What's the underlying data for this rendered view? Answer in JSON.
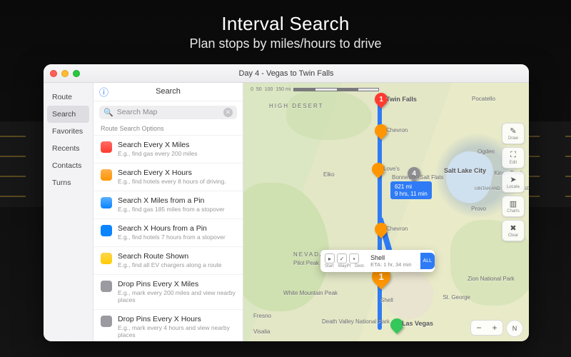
{
  "hero": {
    "title": "Interval Search",
    "subtitle": "Plan stops by miles/hours to drive"
  },
  "window": {
    "title": "Day 4 - Vegas to Twin Falls"
  },
  "leftnav": {
    "items": [
      "Route",
      "Search",
      "Favorites",
      "Recents",
      "Contacts",
      "Turns"
    ],
    "selectedIndex": 1
  },
  "midpane": {
    "header": "Search",
    "search_placeholder": "Search Map",
    "section": "Route Search Options",
    "options": [
      {
        "icon": "red",
        "title": "Search Every X Miles",
        "sub": "E.g., find gas every 200 miles"
      },
      {
        "icon": "teal",
        "title": "Search Every X Hours",
        "sub": "E.g., find hotels every 8 hours of driving."
      },
      {
        "icon": "blue",
        "title": "Search X Miles from a Pin",
        "sub": "E.g., find gas 185 miles from a stopover"
      },
      {
        "icon": "blue2",
        "title": "Search X Hours from a Pin",
        "sub": "E.g., find hotels 7 hours from a stopover"
      },
      {
        "icon": "yellow",
        "title": "Search Route Shown",
        "sub": "E.g., find all EV chargers along a route"
      },
      {
        "icon": "gray",
        "title": "Drop Pins Every X Miles",
        "sub": "E.g., mark every 200 miles and view nearby places"
      },
      {
        "icon": "gray",
        "title": "Drop Pins Every X Hours",
        "sub": "E.g., mark every 4 hours and view nearby places"
      }
    ]
  },
  "map": {
    "scale_labels": [
      "0",
      "50",
      "100",
      "150 mi"
    ],
    "region_labels": {
      "high_desert": "HIGH DESERT",
      "twin_falls": "Twin Falls",
      "pocatello": "Pocatello",
      "chevron1": "Chevron",
      "chevron2": "Chevron",
      "loves": "Love's",
      "elko": "Elko",
      "bonneville": "Bonneville Salt Flats",
      "ogden": "Ogden",
      "salt_lake": "Salt Lake City",
      "kings_peak": "Kings Peak",
      "uintah": "UINTAH AND OURAY RESERVATION",
      "provo": "Provo",
      "nevada": "NEVADA",
      "pilot": "Pilot Peak",
      "white": "White Mountain Peak",
      "fresno": "Fresno",
      "visalia": "Visalia",
      "shell": "Shell",
      "las_vegas": "Las Vegas",
      "st_george": "St. George",
      "zion": "Zion National Park",
      "death_valley": "Death Valley National Park"
    },
    "badge": {
      "line1": "621 mi",
      "line2": "9 hrs, 11 min"
    },
    "popover": {
      "icons": [
        "Start",
        "WayPt",
        "Dest."
      ],
      "title": "Shell",
      "sub": "ETA: 1 hr, 34 min",
      "side": "ALL"
    },
    "pins": {
      "end": "1",
      "wp1": "",
      "wp2": "",
      "wp3": "",
      "graynum": "4",
      "big": "1",
      "start": ""
    },
    "tools": [
      "Draw",
      "Edit",
      "Locate",
      "Charts",
      "Clear"
    ],
    "compass": "N"
  },
  "colors": {
    "accent": "#2f7bf6"
  }
}
